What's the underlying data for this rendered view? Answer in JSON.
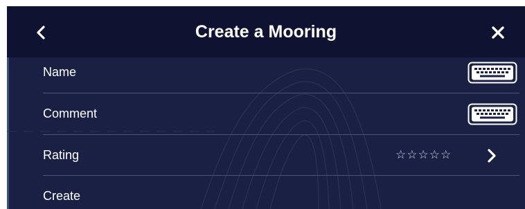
{
  "header": {
    "title": "Create a Mooring",
    "back_icon": "chevron-left-icon",
    "close_icon": "close-icon"
  },
  "rows": [
    {
      "label": "Name",
      "trailing_icon": "keyboard-icon"
    },
    {
      "label": "Comment",
      "trailing_icon": "keyboard-icon"
    },
    {
      "label": "Rating",
      "value": "☆☆☆☆☆",
      "trailing_icon": "chevron-right-icon"
    },
    {
      "label": "Create"
    }
  ],
  "colors": {
    "header_bg": "#0f1331",
    "panel_bg": "#1a2044",
    "text": "#ffffff",
    "separator": "#4a5372"
  }
}
